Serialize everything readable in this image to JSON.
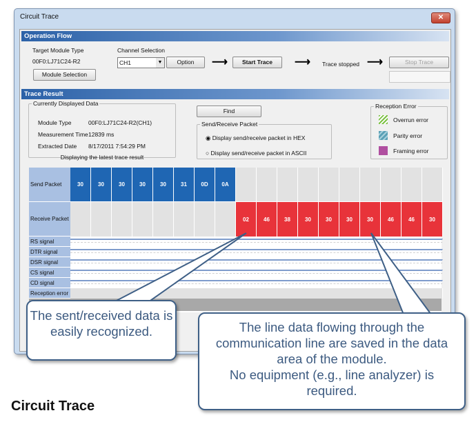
{
  "window": {
    "title": "Circuit Trace",
    "close_icon": "close-icon"
  },
  "operation_flow": {
    "header": "Operation Flow",
    "target_label": "Target Module Type",
    "target_value": "00F0:LJ71C24-R2",
    "module_selection": "Module Selection",
    "channel_label": "Channel Selection",
    "channel_value": "CH1",
    "option": "Option",
    "start": "Start Trace",
    "status": "Trace stopped",
    "stop": "Stop Trace"
  },
  "trace_result": {
    "header": "Trace Result",
    "current": {
      "legend": "Currently Displayed Data",
      "module_type_label": "Module Type",
      "module_type": "00F0:LJ71C24-R2(CH1)",
      "time_label": "Measurement Time",
      "time": "12839 ms",
      "date_label": "Extracted Date",
      "date": "8/17/2011 7:54:29 PM",
      "note": "Displaying the latest trace result"
    },
    "find": "Find",
    "packet": {
      "legend": "Send/Receive Packet",
      "hex": "Display send/receive packet in HEX",
      "ascii": "Display send/receive packet in ASCII",
      "selected": "hex"
    },
    "errors": {
      "legend": "Reception Error",
      "overrun": "Overrun error",
      "parity": "Parity error",
      "framing": "Framing error",
      "colors": {
        "overrun": "#7bc043",
        "parity": "#5aa0b5",
        "framing": "#b04fa0"
      }
    }
  },
  "grid": {
    "columns": 18,
    "colors": {
      "send": "#1f66b3",
      "receive": "#e8333a",
      "label": "#a9c0e2"
    },
    "send_label": "Send Packet",
    "send": [
      "30",
      "30",
      "30",
      "30",
      "30",
      "31",
      "0D",
      "0A"
    ],
    "receive_label": "Receive Packet",
    "receive_start": 8,
    "receive": [
      "02",
      "46",
      "38",
      "30",
      "30",
      "30",
      "30",
      "46",
      "46",
      "30"
    ],
    "signals": [
      "RS signal",
      "DTR signal",
      "DSR signal",
      "CS signal",
      "CD signal"
    ],
    "reception_error": "Reception error"
  },
  "callouts": {
    "left": "The sent/received data is easily recognized.",
    "right_lines": [
      "The line data flowing through the communication line are saved in the data area of the module.",
      "No equipment (e.g., line analyzer) is required."
    ]
  },
  "caption": "Circuit Trace"
}
